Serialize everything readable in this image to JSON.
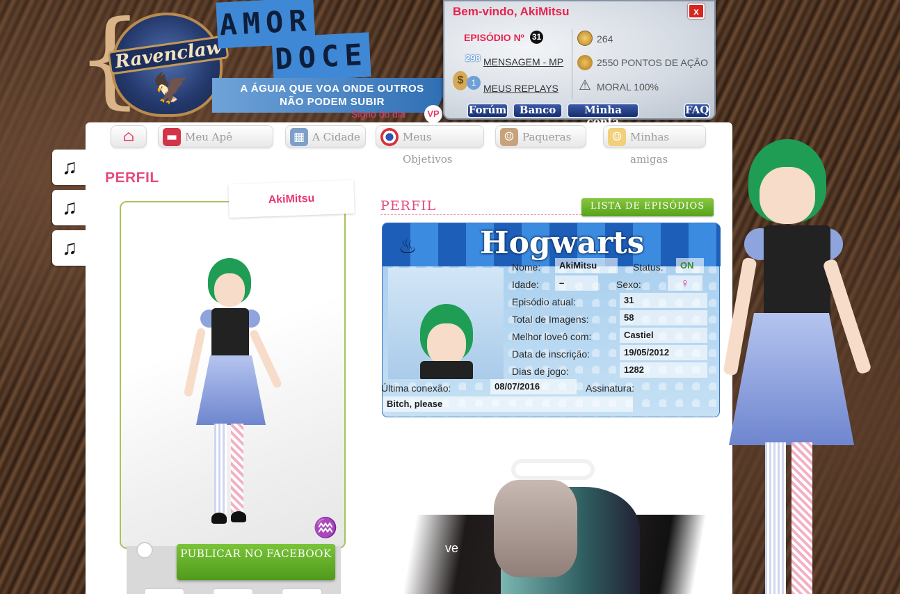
{
  "logo": {
    "crest_text": "Ravenclaw",
    "amor": "AMOR",
    "doce": "DOCE",
    "tagline_1": "A ÁGUIA QUE VOA ONDE OUTROS",
    "tagline_2": "NÃO PODEM SUBIR"
  },
  "signo": {
    "label": "Signo do dia",
    "icon": "VP"
  },
  "welcome": {
    "title": "Bem-vindo, AkiMitsu",
    "close": "x",
    "episode_label": "EPISÓDIO Nº",
    "episode_number": "31",
    "messages_count": "298",
    "messages_link": "MENSAGEM - MP",
    "replays_count": "1",
    "replays_link": "MEUS REPLAYS",
    "coins": "264",
    "action_points": "2550 PONTOS DE AÇÃO",
    "moral": "MORAL 100%",
    "buttons": {
      "forum": "Forúm",
      "banco": "Banco",
      "conta": "Minha conta",
      "faq": "FAQ"
    }
  },
  "nav": {
    "tabs": [
      {
        "label": "",
        "icon": "home-icon"
      },
      {
        "label": "Meu Apê",
        "icon": "sofa-icon"
      },
      {
        "label": "A Cidade",
        "icon": "city-icon"
      },
      {
        "label": "Meus Objetivos",
        "icon": "target-icon"
      },
      {
        "label": "Paqueras",
        "icon": "boy-icon"
      },
      {
        "label": "Minhas amigas",
        "icon": "girl-icon"
      }
    ]
  },
  "music": [
    "♫",
    "♫",
    "♫"
  ],
  "page": {
    "title": "PERFIL"
  },
  "avatar": {
    "name": "AkiMitsu",
    "zodiac_symbol": "♒",
    "fb_button": "PUBLICAR NO FACEBOOK"
  },
  "profile": {
    "heading": "PERFIL",
    "episodes_button": "LISTA DE EPISÓDIOS",
    "card_title": "Hogwarts",
    "fields": {
      "nome_label": "Nome:",
      "nome": "AkiMitsu",
      "status_label": "Status:",
      "status": "ON",
      "idade_label": "Idade:",
      "idade": "–",
      "sexo_label": "Sexo:",
      "sexo": "♀",
      "episodio_label": "Episódio atual:",
      "episodio": "31",
      "imagens_label": "Total de Imagens:",
      "imagens": "58",
      "loveo_label": "Melhor loveô com:",
      "loveo": "Castiel",
      "inscricao_label": "Data de inscrição:",
      "inscricao": "19/05/2012",
      "dias_label": "Dias de jogo:",
      "dias": "1282",
      "conexao_label": "Última conexão:",
      "conexao": "08/07/2016",
      "assinatura_label": "Assinatura:",
      "assinatura": "Bitch, please"
    }
  },
  "collage": {
    "text": "ve"
  }
}
